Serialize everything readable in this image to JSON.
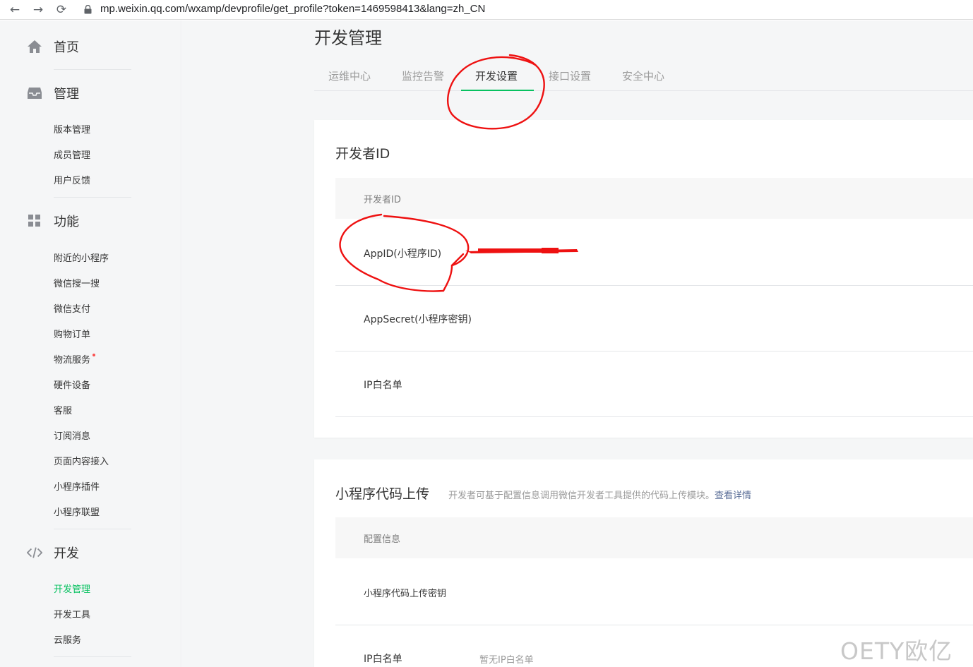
{
  "browser": {
    "back": "←",
    "forward": "→",
    "reload": "⟳",
    "url": "mp.weixin.qq.com/wxamp/devprofile/get_profile?token=1469598413&lang=zh_CN"
  },
  "sidebar": {
    "home": "首页",
    "manage": {
      "label": "管理",
      "items": [
        "版本管理",
        "成员管理",
        "用户反馈"
      ]
    },
    "features": {
      "label": "功能",
      "items": [
        "附近的小程序",
        "微信搜一搜",
        "微信支付",
        "购物订单",
        "物流服务",
        "硬件设备",
        "客服",
        "订阅消息",
        "页面内容接入",
        "小程序插件",
        "小程序联盟"
      ]
    },
    "dev": {
      "label": "开发",
      "items": [
        "开发管理",
        "开发工具",
        "云服务"
      ]
    }
  },
  "main": {
    "title": "开发管理",
    "tabs": [
      "运维中心",
      "监控告警",
      "开发设置",
      "接口设置",
      "安全中心"
    ],
    "active_tab": "开发设置",
    "dev_id_card": {
      "title": "开发者ID",
      "header": "开发者ID",
      "rows": [
        "AppID(小程序ID)",
        "AppSecret(小程序密钥)",
        "IP白名单"
      ]
    },
    "upload_card": {
      "title": "小程序代码上传",
      "desc": "开发者可基于配置信息调用微信开发者工具提供的代码上传模块。",
      "desc_link": "查看详情",
      "header": "配置信息",
      "row_key_label": "小程序代码上传密钥",
      "ip_label": "IP白名单",
      "ip_value": "暂无IP白名单"
    }
  },
  "watermark": "OETY欧亿",
  "colors": {
    "accent": "#07c160",
    "link": "#576b95",
    "annotation": "#ee1111"
  }
}
